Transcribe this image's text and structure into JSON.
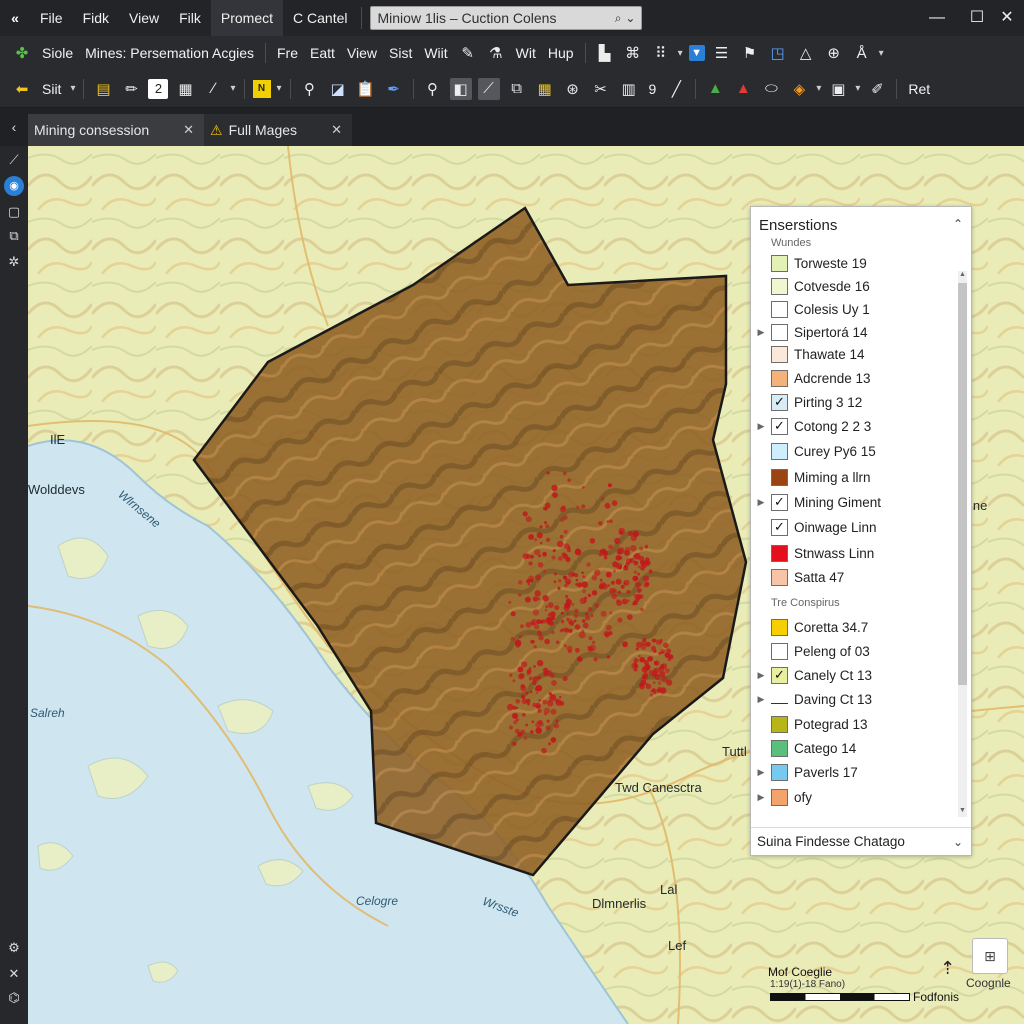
{
  "titlebar": {
    "app_icon": "«",
    "menus": [
      "File",
      "Fidk",
      "View",
      "Filk",
      "Promect",
      "C Cantel"
    ],
    "search_value": "Miniow 1lis – Cuction Colens",
    "search_icon": "search-icon",
    "controls": [
      "—",
      "☐",
      "✕"
    ]
  },
  "toolbar1": {
    "home_label": "Siole",
    "title_label": "Mines: Persemation Acgies",
    "menus": [
      "Fre",
      "Eatt",
      "View",
      "Sist",
      "Wiit",
      "Wit",
      "Hup"
    ]
  },
  "toolbar2": {
    "select_label": "Siit",
    "page_number": "2",
    "zoom_number": "9",
    "right_label": "Ret"
  },
  "tabs": [
    {
      "label": "Mining consession",
      "close": "✕"
    },
    {
      "label": "Full Mages",
      "close": "✕"
    }
  ],
  "legend": {
    "title": "Enserstions",
    "collapse": "⌃",
    "group1": "Wundes",
    "group2": "Tre Conspirus",
    "items": [
      {
        "label": "Torweste 19",
        "color": "#e3f0b6",
        "checked": false,
        "expander": false
      },
      {
        "label": "Cotvesde 16",
        "color": "#eef7cf",
        "checked": false,
        "expander": false
      },
      {
        "label": "Colesis Uy 1",
        "color": "#ffffff",
        "checked": false,
        "expander": false
      },
      {
        "label": "Sipertorá 14",
        "color": "#ffffff",
        "checked": false,
        "expander": true
      },
      {
        "label": "Thawate 14",
        "color": "#fbe8d8",
        "checked": false,
        "expander": false
      },
      {
        "label": "Adcrende 13",
        "color": "#f4b27a",
        "checked": false,
        "expander": false
      },
      {
        "label": "Pirting 3 12",
        "color": "#d7ecf5",
        "checked": true,
        "expander": false
      },
      {
        "label": "Cotong 2 2 3",
        "color": "#ffffff",
        "checked": true,
        "expander": true
      },
      {
        "label": "Curey Py6 15",
        "color": "#cdeefa",
        "checked": false,
        "expander": false
      },
      {
        "label": "Miming a llrn",
        "color": "#9a4413",
        "checked": false,
        "expander": false
      },
      {
        "label": "Mining Giment",
        "color": "#ffffff",
        "checked": true,
        "expander": true
      },
      {
        "label": "Oinwage Linn",
        "color": "#ffffff",
        "checked": true,
        "expander": false
      },
      {
        "label": "Stnwass Linn",
        "color": "#e4101e",
        "checked": false,
        "expander": false
      },
      {
        "label": "Satta 47",
        "color": "#f7c4a8",
        "checked": false,
        "expander": false
      },
      {
        "label": "Coretta 34.7",
        "color": "#f5cf00",
        "checked": false,
        "expander": false
      },
      {
        "label": "Peleng of 03",
        "color": "#ffffff",
        "checked": false,
        "expander": false
      },
      {
        "label": "Canely Ct 13",
        "color": "#e8f0a0",
        "checked": true,
        "expander": true
      },
      {
        "label": "Daving Ct 13",
        "color": "none",
        "checked": false,
        "expander": true
      },
      {
        "label": "Potegrad 13",
        "color": "#b7b614",
        "checked": false,
        "expander": false
      },
      {
        "label": "Catego 14",
        "color": "#58c07a",
        "checked": false,
        "expander": false
      },
      {
        "label": "Paverls 17",
        "color": "#78c9f0",
        "checked": false,
        "expander": true
      },
      {
        "label": "ofy",
        "color": "#f3a36b",
        "checked": false,
        "expander": true
      }
    ],
    "footer": "Suina Findesse Chatago"
  },
  "map_labels": [
    {
      "text": "Wolddevs",
      "kind": "land"
    },
    {
      "text": "Wlrnsene",
      "kind": "water"
    },
    {
      "text": "Salreh",
      "kind": "water"
    },
    {
      "text": "Twd Canesctra",
      "kind": "land"
    },
    {
      "text": "Celogre",
      "kind": "water"
    },
    {
      "text": "Wrsste",
      "kind": "water"
    },
    {
      "text": "Dlmnerlis",
      "kind": "land"
    },
    {
      "text": "Tuttl",
      "kind": "land"
    },
    {
      "text": "Lal",
      "kind": "land"
    },
    {
      "text": "Lef",
      "kind": "land"
    },
    {
      "text": "lne",
      "kind": "land"
    },
    {
      "text": "IlE",
      "kind": "land"
    }
  ],
  "map_controls": {
    "scale_title": "Mof Coeglie",
    "scale_sub": "1:19(1)-18 Fano)",
    "scale_end": "Fodfonis",
    "attribution": "Coognle",
    "north_icon": "north-arrow-icon",
    "zoom_icon": "zoom-control-icon"
  },
  "colors": {
    "concession_fill": "#8a5a1c",
    "concession_stroke": "#1a1a1a",
    "hotspot": "#c0191c",
    "land": "#e9e9b5",
    "water": "#cfe6f0"
  }
}
